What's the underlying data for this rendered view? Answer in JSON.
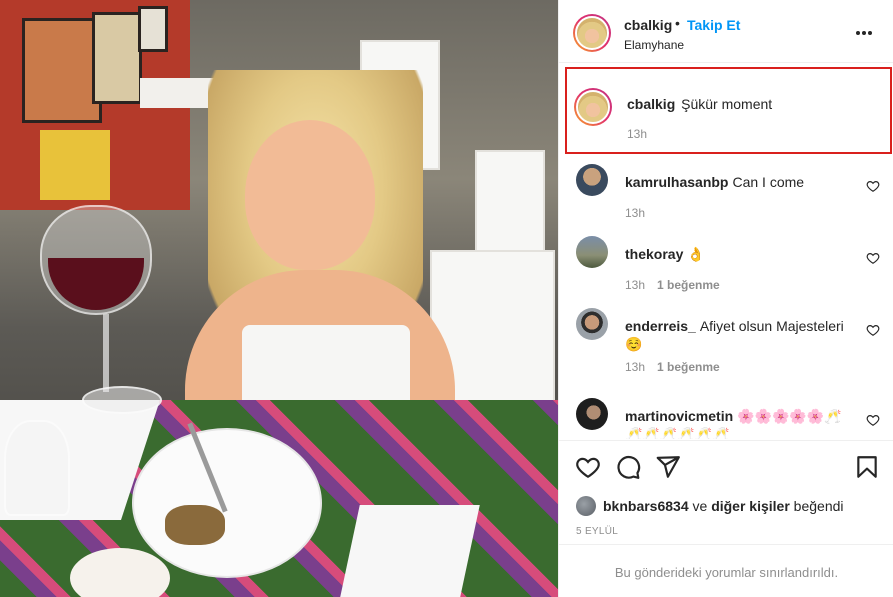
{
  "post": {
    "username": "cbalkig",
    "dot": "•",
    "follow_label": "Takip Et",
    "location": "Elamyhane",
    "more_icon": "more-horizontal-icon"
  },
  "caption": {
    "username": "cbalkig",
    "text": "Şükür moment",
    "time": "13h"
  },
  "comments": [
    {
      "username": "kamrulhasanbp",
      "text": "Can I come",
      "time": "13h",
      "likes": ""
    },
    {
      "username": "thekoray",
      "text": "👌",
      "time": "13h",
      "likes": "1 beğenme"
    },
    {
      "username": "enderreis_",
      "text": "Afiyet olsun Majesteleri ☺️",
      "time": "13h",
      "likes": "1 beğenme"
    },
    {
      "username": "martinovicmetin",
      "text": "🌸🌸🌸🌸🌸🥂🥂🥂🥂🥂🥂🥂",
      "time": "",
      "likes": ""
    }
  ],
  "actions": {
    "like_icon": "heart-icon",
    "comment_icon": "comment-icon",
    "share_icon": "share-icon",
    "save_icon": "bookmark-icon"
  },
  "likes": {
    "first_user": "bknbars6834",
    "connector": "ve",
    "others": "diğer kişiler",
    "suffix": "beğendi"
  },
  "date": "5 EYLÜL",
  "restricted_text": "Bu gönderideki yorumlar sınırlandırıldı.",
  "colors": {
    "link": "#0095f6",
    "highlight_border": "#d9201d",
    "muted": "#8e8e8e"
  }
}
